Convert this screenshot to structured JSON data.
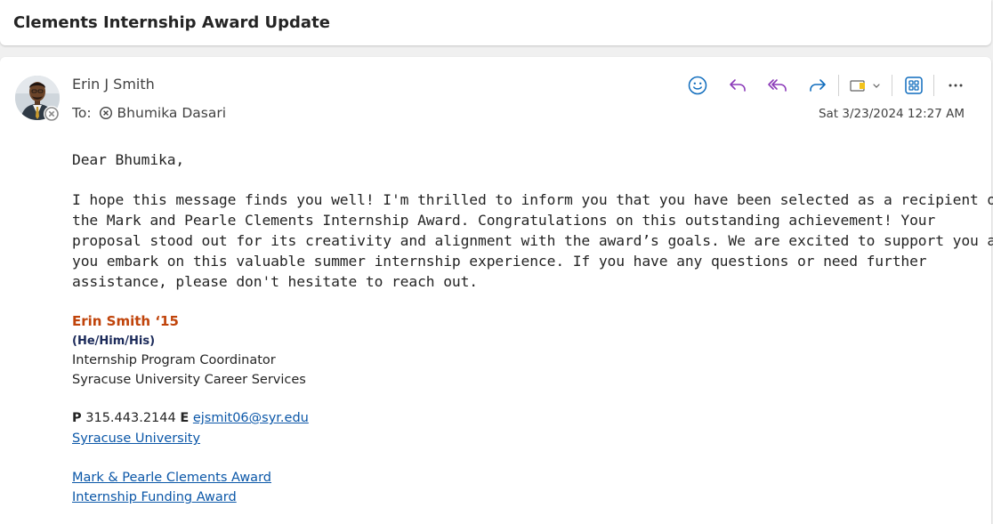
{
  "subject": "Clements Internship Award Update",
  "sender": {
    "name": "Erin J Smith",
    "to_label": "To:",
    "recipient": "Bhumika Dasari",
    "date": "Sat 3/23/2024 12:27 AM"
  },
  "toolbar": {
    "icons": [
      "emoji-icon",
      "reply-icon",
      "reply-all-icon",
      "forward-icon",
      "tag-icon",
      "apps-icon",
      "more-icon"
    ],
    "accent_purple": "#8b3ab8",
    "accent_blue": "#0f6cbd"
  },
  "body": {
    "greeting": "Dear Bhumika,",
    "lines": [
      "I hope this message finds you well! I'm thrilled to inform you that you have been selected as a recipient of",
      "the Mark and Pearle Clements Internship Award. Congratulations on this outstanding achievement! Your",
      "proposal stood out for its creativity and alignment with the award’s goals. We are excited to support you as",
      "you embark on this valuable summer internship experience. If you have any questions or need further",
      "assistance, please don't hesitate to reach out."
    ]
  },
  "signature": {
    "name": "Erin Smith ‘15",
    "pronouns": "(He/Him/His)",
    "title": "Internship Program Coordinator",
    "org": "Syracuse University Career Services",
    "phone_label": "P",
    "phone": "315.443.2144",
    "email_label": "E",
    "email": "ejsmit06@syr.edu",
    "university_link": "Syracuse University",
    "link1": "Mark & Pearle Clements Award",
    "link2": "Internship Funding Award",
    "name_color": "#c0440b",
    "link_color": "#0b57a8"
  }
}
